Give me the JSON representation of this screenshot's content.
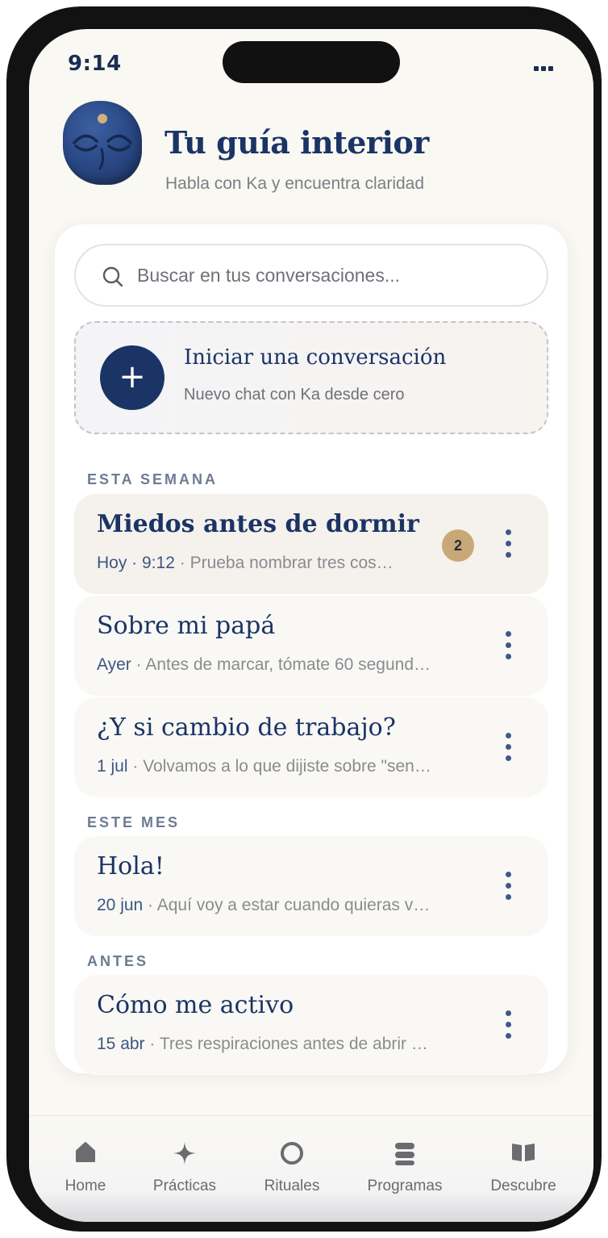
{
  "status_bar": {
    "time": "9:14"
  },
  "header": {
    "title": "Tu guía interior",
    "subtitle": "Habla con Ka y encuentra claridad"
  },
  "search": {
    "placeholder": "Buscar en tus conversaciones..."
  },
  "new_chat": {
    "title": "Iniciar una conversación",
    "subtitle": "Nuevo chat con Ka desde cero",
    "button_icon": "+"
  },
  "sections": [
    {
      "label": "ESTA SEMANA"
    },
    {
      "label": "ESTE MES"
    },
    {
      "label": "ANTES"
    }
  ],
  "conversations": [
    {
      "title": "Miedos antes de dormir",
      "date": "Hoy · 9:12",
      "preview": "Prueba nombrar tres cos…",
      "unread": "2",
      "active": true
    },
    {
      "title": "Sobre mi papá",
      "date": "Ayer",
      "preview": "Antes de marcar, tómate 60 segund…"
    },
    {
      "title": "¿Y si cambio de trabajo?",
      "date": "1 jul",
      "preview": "Volvamos a lo que dijiste sobre \"sen…"
    },
    {
      "title": "Hola!",
      "date": "20 jun",
      "preview": "Aquí voy a estar cuando quieras v…"
    },
    {
      "title": "Cómo me activo",
      "date": "15 abr",
      "preview": "Tres respiraciones antes de abrir …"
    }
  ],
  "tabbar": [
    {
      "label": "Home",
      "icon": "home-icon"
    },
    {
      "label": "Prácticas",
      "icon": "sparkle-icon"
    },
    {
      "label": "Rituales",
      "icon": "ring-icon"
    },
    {
      "label": "Programas",
      "icon": "stack-icon"
    },
    {
      "label": "Descubre",
      "icon": "book-icon"
    }
  ],
  "colors": {
    "primary": "#1b3466",
    "badge": "#c9a877",
    "background": "#f9f8f3",
    "section_label": "#6d7b92"
  }
}
